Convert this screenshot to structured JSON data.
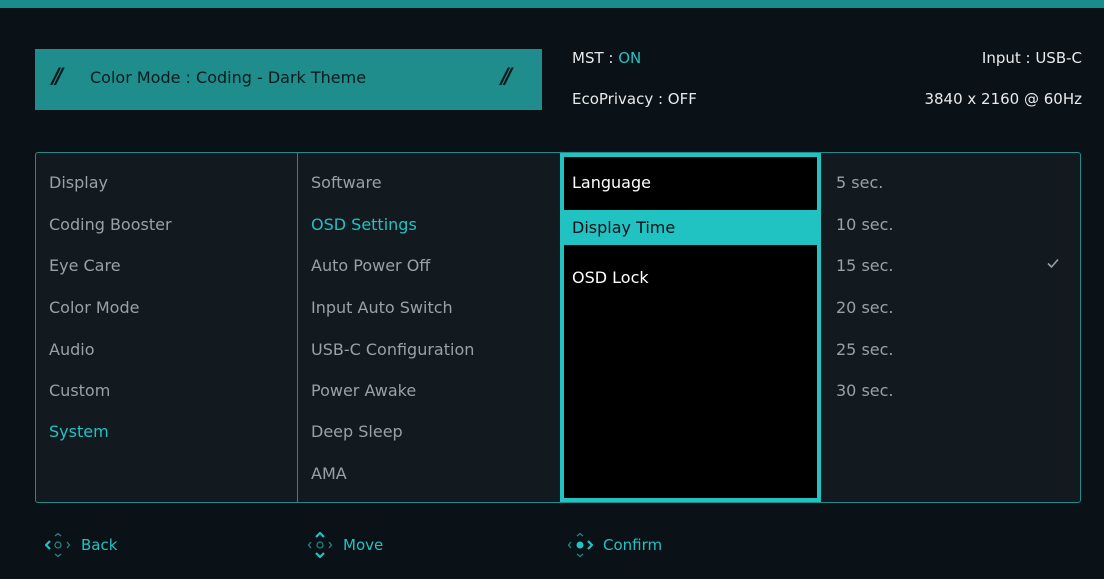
{
  "header": {
    "color_mode_label": "Color Mode : Coding - Dark Theme",
    "mst_label": "MST : ",
    "mst_value": "ON",
    "ecoprivacy": "EcoPrivacy : OFF",
    "input": "Input : USB-C",
    "resolution": "3840 x 2160 @ 60Hz"
  },
  "menu": {
    "col1": [
      "Display",
      "Coding Booster",
      "Eye Care",
      "Color Mode",
      "Audio",
      "Custom",
      "System"
    ],
    "col2": [
      "Software",
      "OSD Settings",
      "Auto Power Off",
      "Input Auto Switch",
      "USB-C Configuration",
      "Power Awake",
      "Deep Sleep",
      "AMA"
    ],
    "col3": [
      "Language",
      "Display Time",
      "OSD Lock"
    ],
    "col4": [
      "5 sec.",
      "10 sec.",
      "15 sec.",
      "20 sec.",
      "25 sec.",
      "30 sec."
    ],
    "checked_option": "15 sec."
  },
  "footer": {
    "back": "Back",
    "move": "Move",
    "confirm": "Confirm"
  },
  "colors": {
    "accent": "#21c2c2",
    "banner": "#1f8d8b",
    "background": "#0a1117"
  }
}
